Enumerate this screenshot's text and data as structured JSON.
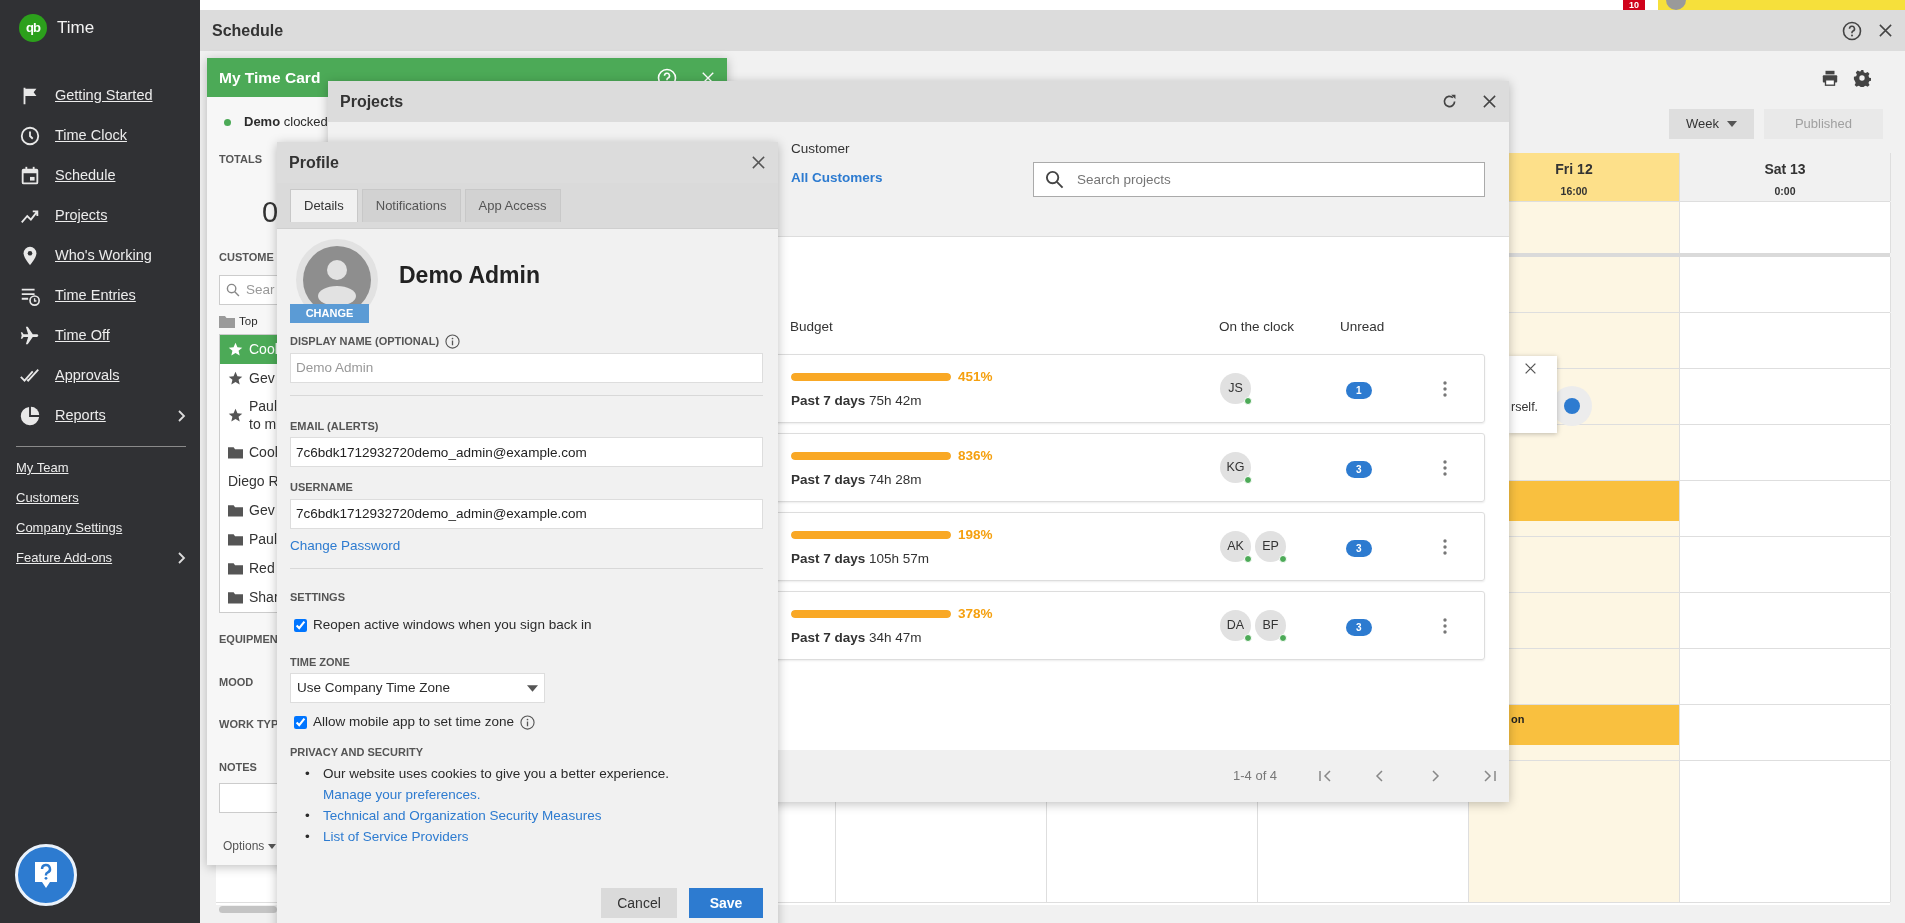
{
  "top_strip": {
    "badge": "10"
  },
  "sidebar": {
    "logo_mark": "qb",
    "app_name": "Time",
    "items": [
      {
        "label": "Getting Started",
        "has_submenu": false
      },
      {
        "label": "Time Clock",
        "has_submenu": false
      },
      {
        "label": "Schedule",
        "has_submenu": false
      },
      {
        "label": "Projects",
        "has_submenu": false
      },
      {
        "label": "Who's Working",
        "has_submenu": false
      },
      {
        "label": "Time Entries",
        "has_submenu": false
      },
      {
        "label": "Time Off",
        "has_submenu": false
      },
      {
        "label": "Approvals",
        "has_submenu": false
      },
      {
        "label": "Reports",
        "has_submenu": true
      }
    ],
    "links": [
      {
        "label": "My Team",
        "has_submenu": false
      },
      {
        "label": "Customers",
        "has_submenu": false
      },
      {
        "label": "Company Settings",
        "has_submenu": false
      },
      {
        "label": "Feature Add-ons",
        "has_submenu": true
      }
    ]
  },
  "schedule": {
    "title": "Schedule",
    "view": "Week",
    "publish_button": "Published",
    "publish_enabled": false,
    "columns": [
      {
        "day": "Fri 12",
        "time": "16:00",
        "today": true
      },
      {
        "day": "Sat 13",
        "time": "0:00",
        "today": false
      }
    ],
    "rows": [
      {
        "shift": false
      },
      {
        "shift": false
      },
      {
        "shift": false
      },
      {
        "shift": false
      },
      {
        "shift": false
      },
      {
        "shift": true
      },
      {
        "shift": false
      },
      {
        "shift": false
      },
      {
        "shift": false
      },
      {
        "shift": true,
        "shift_text": "on"
      },
      {
        "shift": false
      }
    ],
    "popover": {
      "text": "rself."
    }
  },
  "time_card": {
    "title": "My Time Card",
    "status_user": "Demo",
    "status_text": "clocked",
    "totals_label": "TOTALS",
    "total_value": "0",
    "customers_label": "CUSTOME",
    "search_placeholder": "Sear",
    "top_label": "Top",
    "items": [
      {
        "kind": "star",
        "lines": [
          "Cool"
        ],
        "selected": true
      },
      {
        "kind": "star",
        "lines": [
          "Gev"
        ],
        "selected": false
      },
      {
        "kind": "star",
        "lines": [
          "Paul",
          "to m"
        ],
        "selected": false
      },
      {
        "kind": "folder",
        "lines": [
          "Cool"
        ],
        "selected": false
      },
      {
        "kind": "text",
        "lines": [
          "Diego R"
        ],
        "selected": false
      },
      {
        "kind": "folder",
        "lines": [
          "Gev"
        ],
        "selected": false
      },
      {
        "kind": "folder",
        "lines": [
          "Paul"
        ],
        "selected": false
      },
      {
        "kind": "folder",
        "lines": [
          "Red"
        ],
        "selected": false
      },
      {
        "kind": "folder",
        "lines": [
          "Shar"
        ],
        "selected": false
      }
    ],
    "fields": [
      "EQUIPMEN",
      "MOOD",
      "WORK TYP",
      "NOTES"
    ],
    "options": "Options"
  },
  "projects": {
    "title": "Projects",
    "customer_label": "Customer",
    "customer_value": "All Customers",
    "search_placeholder": "Search projects",
    "columns": [
      "Budget",
      "On the clock",
      "Unread"
    ],
    "rows": [
      {
        "level": 1,
        "percent": "451%",
        "period": "Past 7 days",
        "hours": "75h 42m",
        "people": [
          {
            "initials": "JS",
            "online": true
          }
        ],
        "unread": "1"
      },
      {
        "level": 1,
        "percent": "836%",
        "period": "Past 7 days",
        "hours": "74h 28m",
        "people": [
          {
            "initials": "KG",
            "online": true
          }
        ],
        "unread": "3"
      },
      {
        "level": 1,
        "percent": "198%",
        "period": "Past 7 days",
        "hours": "105h 57m",
        "people": [
          {
            "initials": "AK",
            "online": true
          },
          {
            "initials": "EP",
            "online": true
          }
        ],
        "unread": "3"
      },
      {
        "level": 1,
        "percent": "378%",
        "period": "Past 7 days",
        "hours": "34h 47m",
        "people": [
          {
            "initials": "DA",
            "online": true
          },
          {
            "initials": "BF",
            "online": true
          }
        ],
        "unread": "3"
      }
    ],
    "pager": "1-4 of 4"
  },
  "profile": {
    "title": "Profile",
    "tabs": [
      {
        "label": "Details",
        "selected": true
      },
      {
        "label": "Notifications",
        "selected": false
      },
      {
        "label": "App Access",
        "selected": false
      }
    ],
    "name": "Demo Admin",
    "change_label": "CHANGE",
    "display_name": {
      "label": "DISPLAY NAME (OPTIONAL)",
      "placeholder": "Demo Admin"
    },
    "email": {
      "label": "EMAIL (ALERTS)",
      "value": "7c6bdk1712932720demo_admin@example.com"
    },
    "username": {
      "label": "USERNAME",
      "value": "7c6bdk1712932720demo_admin@example.com"
    },
    "change_password": "Change Password",
    "settings_label": "SETTINGS",
    "reopen": {
      "label": "Reopen active windows when you sign back in",
      "checked": true
    },
    "time_zone": {
      "label": "TIME ZONE",
      "value": "Use Company Time Zone"
    },
    "mobile_tz": {
      "label": "Allow mobile app to set time zone",
      "checked": true
    },
    "privacy_label": "PRIVACY AND SECURITY",
    "privacy_items": [
      {
        "bullet": "•",
        "text": "Our website uses cookies to give you a better experience.",
        "link": "Manage your preferences."
      },
      {
        "bullet": "•",
        "link": "Technical and Organization Security Measures"
      },
      {
        "bullet": "•",
        "link": "List of Service Providers"
      }
    ],
    "cancel": "Cancel",
    "save": "Save"
  }
}
